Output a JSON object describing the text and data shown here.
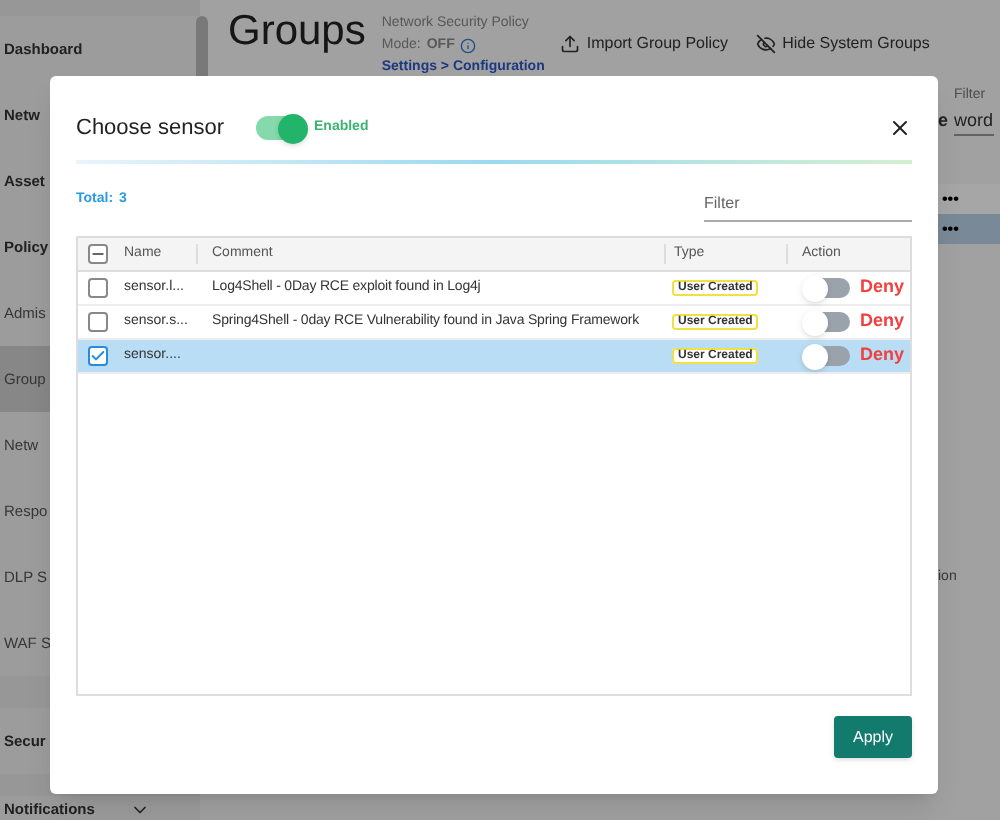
{
  "sidebar": {
    "items": [
      {
        "label": "Dashboard",
        "kind": "header",
        "selected": false
      },
      {
        "label": "Netw",
        "kind": "header",
        "selected": false
      },
      {
        "label": "Asset",
        "kind": "header",
        "selected": false
      },
      {
        "label": "Policy",
        "kind": "header",
        "selected": false
      },
      {
        "label": "Admis",
        "kind": "item",
        "selected": false
      },
      {
        "label": "Group",
        "kind": "item",
        "selected": true
      },
      {
        "label": "Netw",
        "kind": "item",
        "selected": false
      },
      {
        "label": "Respo",
        "kind": "item",
        "selected": false
      },
      {
        "label": "DLP S",
        "kind": "item",
        "selected": false
      },
      {
        "label": "WAF S",
        "kind": "item",
        "selected": false
      },
      {
        "label": "Secur",
        "kind": "header",
        "selected": false
      },
      {
        "label": "Notifications",
        "kind": "menu",
        "selected": false
      }
    ]
  },
  "page": {
    "title": "Groups",
    "policy_label": "Network Security Policy",
    "mode_label": "Mode:",
    "mode_value": "OFF",
    "settings_link": "Settings > Configuration",
    "actions": [
      {
        "label": "Import Group Policy",
        "kind": "import"
      },
      {
        "label": "Hide System Groups",
        "kind": "hide"
      }
    ],
    "right_fragments": {
      "label_fragment": "e",
      "filter_label": "Filter",
      "filter_value": "word",
      "row_menus": [
        {
          "text": "•••",
          "selected": false
        },
        {
          "text": "•••",
          "selected": true
        }
      ],
      "column_fragment": "ion"
    }
  },
  "dialog": {
    "title": "Choose sensor",
    "enabled": {
      "on": true,
      "label": "Enabled"
    },
    "total_label": "Total:",
    "total_value": "3",
    "filter": {
      "placeholder": "Filter"
    },
    "table": {
      "columns": [
        "Name",
        "Comment",
        "Type",
        "Action"
      ],
      "header_checkbox": {
        "indeterminate": true
      },
      "rows": [
        {
          "name": "sensor.l...",
          "comment": "Log4Shell - 0Day RCE exploit found in Log4j",
          "type": "User Created",
          "action_on": false,
          "action": "Deny",
          "checked": false,
          "selected": false
        },
        {
          "name": "sensor.s...",
          "comment": "Spring4Shell - 0day RCE Vulnerability found in Java Spring Framework",
          "type": "User Created",
          "action_on": false,
          "action": "Deny",
          "checked": false,
          "selected": false
        },
        {
          "name": "sensor....",
          "comment": "",
          "type": "User Created",
          "action_on": false,
          "action": "Deny",
          "checked": true,
          "selected": true
        }
      ]
    },
    "apply": "Apply"
  }
}
